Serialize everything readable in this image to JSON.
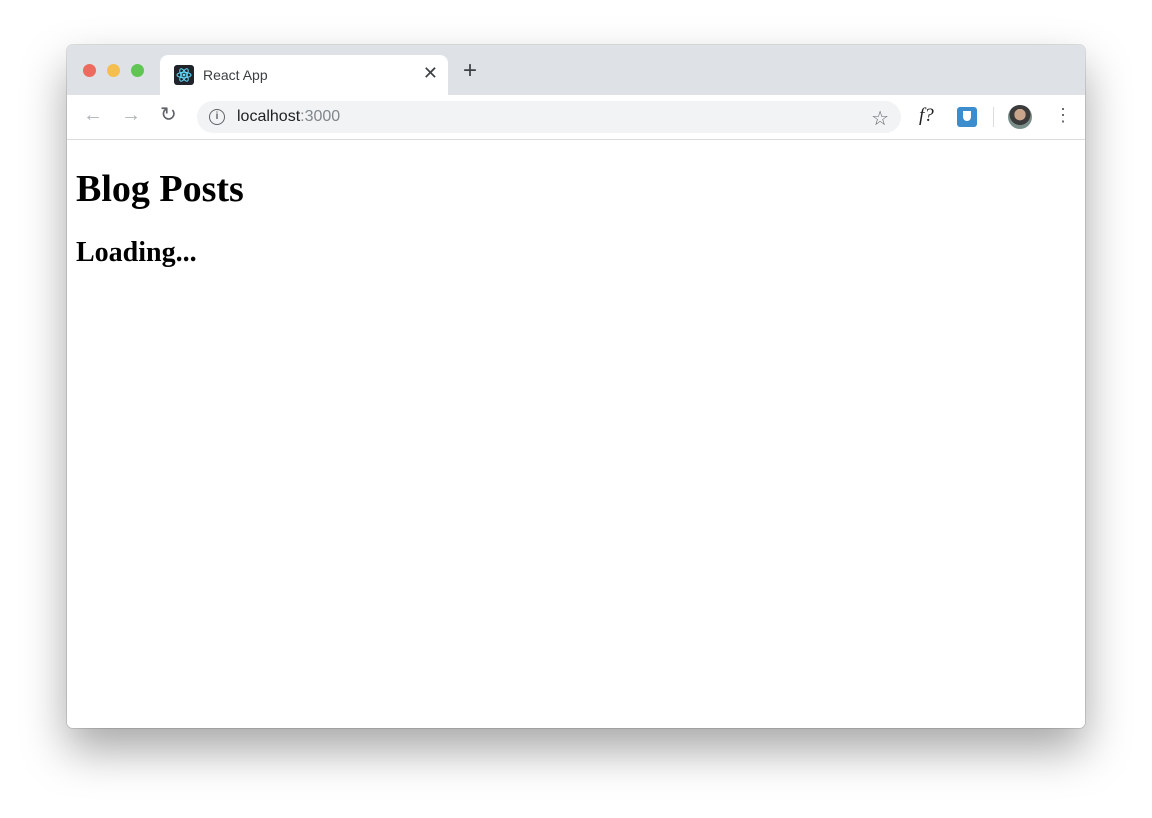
{
  "browser": {
    "tab": {
      "title": "React App",
      "favicon": "react-logo-icon",
      "close_glyph": "✕"
    },
    "new_tab_glyph": "+",
    "nav": {
      "back_glyph": "←",
      "forward_glyph": "→",
      "reload_glyph": "↻"
    },
    "address": {
      "host": "localhost",
      "port": ":3000",
      "info_glyph": "i"
    },
    "star_glyph": "☆",
    "extensions": {
      "fquestion_label": "f?"
    },
    "menu_glyph": "⋮"
  },
  "page": {
    "heading": "Blog Posts",
    "status": "Loading..."
  }
}
